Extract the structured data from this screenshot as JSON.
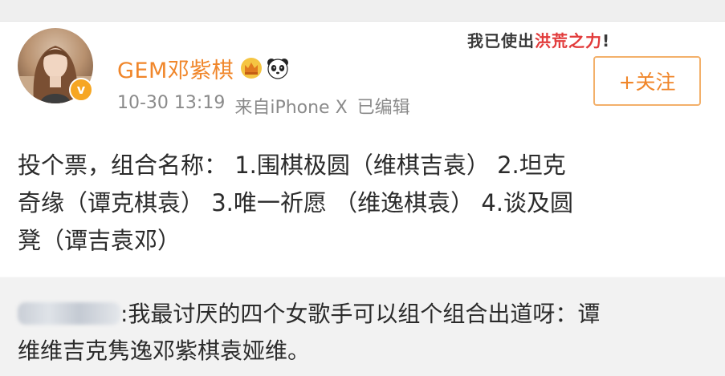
{
  "post": {
    "username": "GEM邓紫棋",
    "verified_mark": "v",
    "timestamp": "10-30 13:19",
    "source": "来自iPhone X",
    "edited": "已编辑",
    "follow_label": "+关注",
    "sticker_prefix": "我已使出",
    "sticker_highlight": "洪荒之力",
    "sticker_suffix": "!",
    "text_lines": [
      "投个票，组合名称：  1.围棋极圆（维棋吉袁）    2.坦克",
      "奇缘（谭克棋袁）  3.唯一祈愿  （维逸棋袁）   4.谈及圆",
      "凳（谭吉袁邓）"
    ]
  },
  "comment": {
    "text_lines": [
      ":我最讨厌的四个女歌手可以组个组合出道呀：谭",
      "维维吉克隽逸邓紫棋袁娅维。"
    ]
  },
  "icons": {
    "crown": "crown-icon",
    "panda": "panda-icon",
    "verified": "verified-badge-icon"
  },
  "colors": {
    "accent": "#f0862a",
    "text": "#2b2b2b",
    "meta": "#8a8a8a"
  }
}
